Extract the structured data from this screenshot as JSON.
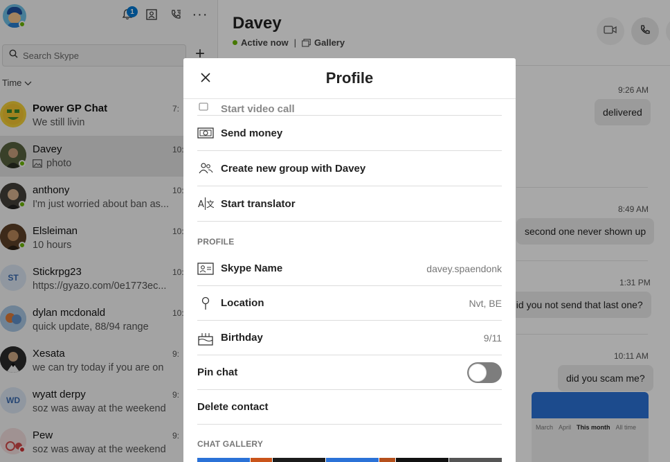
{
  "sidebar": {
    "notification_count": "1",
    "search_placeholder": "Search Skype",
    "sort_label": "Time",
    "conversations": [
      {
        "name": "Power GP Chat",
        "preview": "We still livin",
        "time": "7:",
        "bold": true
      },
      {
        "name": "Davey",
        "preview": "photo",
        "time": "10:",
        "active": true
      },
      {
        "name": "anthony",
        "preview": "I'm just worried about ban as...",
        "time": "10:"
      },
      {
        "name": "Elsleiman",
        "preview": "10 hours",
        "time": "10:"
      },
      {
        "name": "Stickrpg23",
        "preview": "https://gyazo.com/0e1773ec...",
        "time": "10:",
        "initials": "ST"
      },
      {
        "name": "dylan mcdonald",
        "preview": "quick update, 88/94 range",
        "time": "10:"
      },
      {
        "name": "Xesata",
        "preview": "we can try today if you are on",
        "time": "9:"
      },
      {
        "name": "wyatt derpy",
        "preview": "soz was away at the weekend",
        "time": "9:",
        "initials": "WD"
      },
      {
        "name": "Pew",
        "preview": "soz was away at the weekend",
        "time": "9:"
      }
    ]
  },
  "chat": {
    "contact_name": "Davey",
    "status": "Active now",
    "gallery_label": "Gallery",
    "messages": [
      {
        "time": "9:26 AM",
        "text": "delivered"
      },
      {
        "time": "8:49 AM",
        "text": "second one never shown up"
      },
      {
        "time": "1:31 PM",
        "text": "did you not send that last one?"
      },
      {
        "time": "10:11 AM",
        "text": "did you scam me?"
      }
    ],
    "thumb_tabs": [
      "March",
      "April",
      "This month",
      "All time"
    ]
  },
  "profile": {
    "title": "Profile",
    "actions": {
      "video_call": "Start video call",
      "send_money": "Send money",
      "create_group": "Create new group with Davey",
      "translator": "Start translator"
    },
    "section_profile": "PROFILE",
    "skype_name_label": "Skype Name",
    "skype_name_value": "davey.spaendonk",
    "location_label": "Location",
    "location_value": "Nvt, BE",
    "birthday_label": "Birthday",
    "birthday_value": "9/11",
    "pin_chat_label": "Pin chat",
    "pin_chat_on": false,
    "delete_contact_label": "Delete contact",
    "section_gallery": "CHAT GALLERY"
  },
  "colors": {
    "accent": "#0078d4",
    "presence": "#6bb700",
    "toggle_off": "#7d7d7d"
  }
}
